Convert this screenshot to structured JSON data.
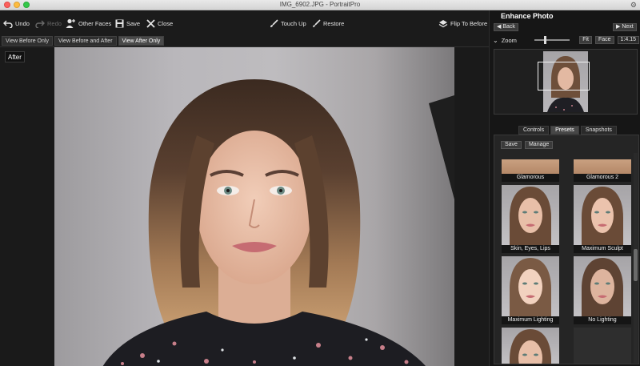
{
  "window": {
    "title": "IMG_6902.JPG - PortraitPro"
  },
  "toolbar": {
    "undo": "Undo",
    "redo": "Redo",
    "other_faces": "Other Faces",
    "save": "Save",
    "close": "Close",
    "touch_up": "Touch Up",
    "restore": "Restore",
    "flip_to_before": "Flip To Before"
  },
  "view_tabs": [
    "View Before Only",
    "View Before and After",
    "View After Only"
  ],
  "active_view_tab": "View After Only",
  "canvas": {
    "label": "After"
  },
  "panel": {
    "title": "Enhance Photo",
    "back": "Back",
    "next": "Next",
    "zoom_label": "Zoom",
    "zoom_level": 0.25,
    "fit": "Fit",
    "face": "Face",
    "zoom_value": "1:4.15",
    "tabs": [
      "Controls",
      "Presets",
      "Snapshots"
    ],
    "active_tab": "Presets",
    "save_btn": "Save",
    "manage_btn": "Manage",
    "presets": [
      {
        "label": "Glamorous"
      },
      {
        "label": "Glamorous 2"
      },
      {
        "label": "Skin, Eyes, Lips"
      },
      {
        "label": "Maximum Sculpt"
      },
      {
        "label": "Maximum Lighting"
      },
      {
        "label": "No Lighting"
      }
    ]
  },
  "colors": {
    "background": "#1b1b1b",
    "panel": "#161616",
    "hair_dark": "#3b2a20",
    "hair_light": "#c89b6a",
    "skin": "#e9c0aa",
    "lips": "#c66c72",
    "dress": "#1d1d22"
  }
}
